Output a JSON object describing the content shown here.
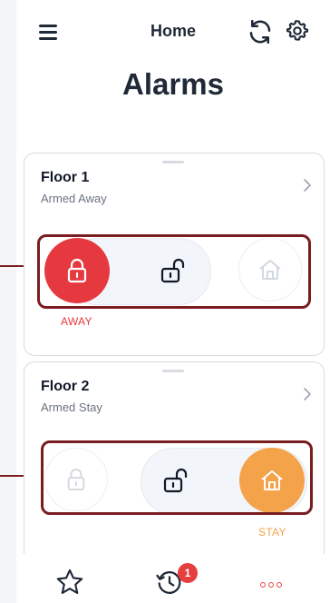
{
  "header": {
    "title": "Home",
    "icons": {
      "menu": "hamburger-menu-icon",
      "refresh": "refresh-icon",
      "settings": "gear-icon"
    }
  },
  "page": {
    "title": "Alarms"
  },
  "floors": [
    {
      "name": "Floor 1",
      "status": "Armed Away",
      "active_mode": "away",
      "active_label": "AWAY",
      "active_color": "#e5393f"
    },
    {
      "name": "Floor 2",
      "status": "Armed Stay",
      "active_mode": "stay",
      "active_label": "STAY",
      "active_color": "#f5a34a"
    }
  ],
  "bottom_nav": {
    "icons": [
      "star-icon",
      "history-icon",
      "more-icon"
    ],
    "history_badge": "1"
  },
  "colors": {
    "highlight_border": "#7a1d20",
    "away_red": "#e5393f",
    "stay_orange": "#f5a34a",
    "badge_red": "#e53e3e"
  }
}
